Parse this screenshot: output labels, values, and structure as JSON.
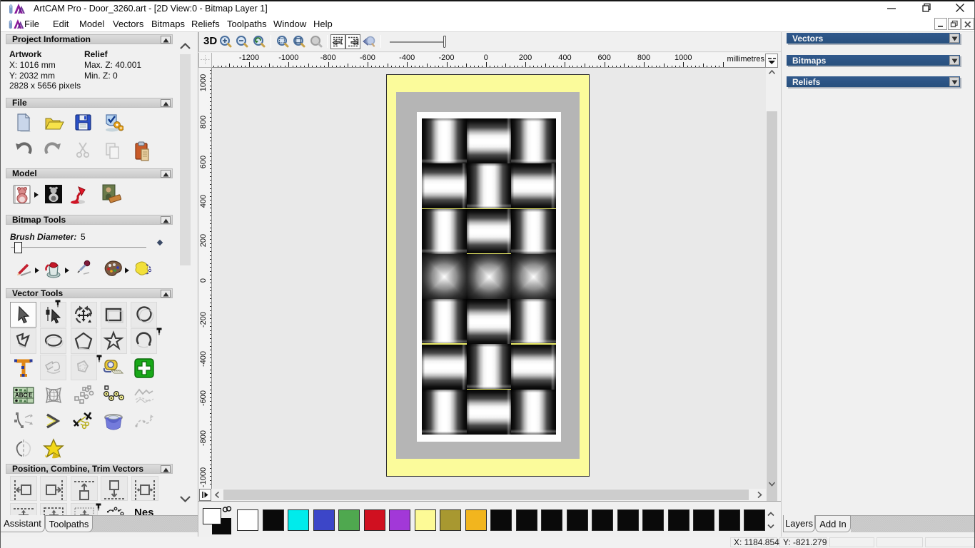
{
  "window": {
    "title": "ArtCAM Pro - Door_3260.art - [2D View:0 - Bitmap Layer 1]",
    "controls": [
      "minimize",
      "restore",
      "close"
    ],
    "mdi_controls": [
      "minimize",
      "restore",
      "close"
    ]
  },
  "menu": {
    "items": [
      "File",
      "Edit",
      "Model",
      "Vectors",
      "Bitmaps",
      "Reliefs",
      "Toolpaths",
      "Window",
      "Help"
    ]
  },
  "view_toolbar": {
    "label_3d": "3D",
    "zoom_group1": [
      "zoom-in",
      "zoom-out",
      "zoom-last"
    ],
    "zoom_group2": [
      "zoom-box",
      "zoom-fit",
      "zoom-object"
    ],
    "nav_group": [
      "snap-left",
      "snap-right",
      "preview-lens"
    ]
  },
  "ruler": {
    "unit": "millimetres",
    "h_labels": [
      "-1200",
      "-1000",
      "-800",
      "-600",
      "-400",
      "-200",
      "0",
      "200",
      "400",
      "600",
      "800",
      "1000"
    ],
    "v_labels": [
      "1000",
      "800",
      "600",
      "400",
      "200",
      "0",
      "-200",
      "-400",
      "-600",
      "-800",
      "-1000"
    ]
  },
  "assistant": {
    "project": {
      "title": "Project Information",
      "artwork_label": "Artwork",
      "relief_label": "Relief",
      "x": "X: 1016 mm",
      "y": "Y: 2032 mm",
      "pixels": "2828 x 5656 pixels",
      "max_z": "Max. Z: 40.001",
      "min_z": "Min. Z: 0"
    },
    "file_section": {
      "title": "File",
      "row1": [
        "new-model",
        "open-model",
        "save-model",
        "options"
      ],
      "row2": [
        "undo",
        "redo",
        "cut",
        "copy",
        "paste"
      ]
    },
    "model_section": {
      "title": "Model",
      "icons": [
        "edit-model",
        "greyscale-model",
        "lighting",
        "texture-relief"
      ]
    },
    "bitmap_section": {
      "title": "Bitmap Tools",
      "brush_label": "Brush Diameter:",
      "brush_value": "5",
      "icons": [
        "paint-brush",
        "flood-fill",
        "colour-picker",
        "colour-palette",
        "magic-select"
      ]
    },
    "vector_section": {
      "title": "Vector Tools",
      "rows": [
        [
          "select-vectors",
          "node-editing",
          "transform-vectors",
          "create-rectangle",
          "create-circle"
        ],
        [
          "create-polyline",
          "create-ellipse",
          "create-polygon",
          "create-star",
          "create-arc"
        ],
        [
          "create-text",
          "block-copy",
          "offset-vector",
          "measure-tool",
          "insert-clipart"
        ],
        [
          "text-frame",
          "distort-vectors",
          "array-copy",
          "fit-arcs",
          "freehand-sketch"
        ],
        [
          "fillet-tool",
          "join-vectors",
          "trim-vectors",
          "spin-vectors",
          "smooth-polyline"
        ],
        [
          "mirror-vectors",
          "star-wizard"
        ]
      ]
    },
    "position_section": {
      "title": "Position, Combine, Trim Vectors",
      "rows": [
        [
          "align-left",
          "align-right",
          "align-top",
          "align-bottom",
          "centre-horizontal"
        ],
        [
          "centre-vertical",
          "centre-in-page",
          "align-pinned",
          "block-nest",
          "nesting"
        ]
      ],
      "nesting_label": "Nes"
    },
    "tabs": [
      "Assistant",
      "Toolpaths"
    ],
    "active_tab": "Assistant"
  },
  "right_panel": {
    "sections": [
      "Vectors",
      "Bitmaps",
      "Reliefs"
    ],
    "tabs": [
      "Layers",
      "Add In"
    ],
    "active_tab": "Layers"
  },
  "palette": {
    "primary": "#ffffff",
    "secondary": "#0a0a0a",
    "swatches": [
      "#ffffff",
      "#0a0a0a",
      "#00ebeb",
      "#3c46c8",
      "#4fa84f",
      "#d01020",
      "#a238d8",
      "#fdfa96",
      "#a89830",
      "#f2b51e",
      "#0a0a0a",
      "#0a0a0a",
      "#0a0a0a",
      "#0a0a0a",
      "#0a0a0a",
      "#0a0a0a",
      "#0a0a0a",
      "#0a0a0a",
      "#0a0a0a",
      "#0a0a0a",
      "#0a0a0a"
    ]
  },
  "status_bar": {
    "x": "X: 1184.854",
    "y": "Y: -821.279",
    "empty_cells": 3
  },
  "artwork": {
    "name": "door-design",
    "border_color": "#fbfb9b",
    "frame_color": "#b5b5b5",
    "panel_color": "#fdfdfd",
    "pattern_rows": [
      [
        "v",
        "h",
        "v"
      ],
      [
        "h",
        "v",
        "h"
      ],
      [
        "v",
        "h",
        "v"
      ],
      [
        "p",
        "p",
        "p"
      ],
      [
        "v",
        "h",
        "v"
      ],
      [
        "h",
        "v",
        "h"
      ],
      [
        "v",
        "h",
        "v"
      ]
    ],
    "guide_lines": [
      {
        "row_boundary": 2,
        "cols": [
          0,
          1,
          2
        ]
      },
      {
        "row_boundary": 3,
        "cols": [
          1
        ]
      },
      {
        "row_boundary": 5,
        "cols": [
          0,
          2
        ]
      },
      {
        "row_boundary": 6,
        "cols": [
          1
        ]
      }
    ],
    "guide_color": "#e9e966"
  }
}
